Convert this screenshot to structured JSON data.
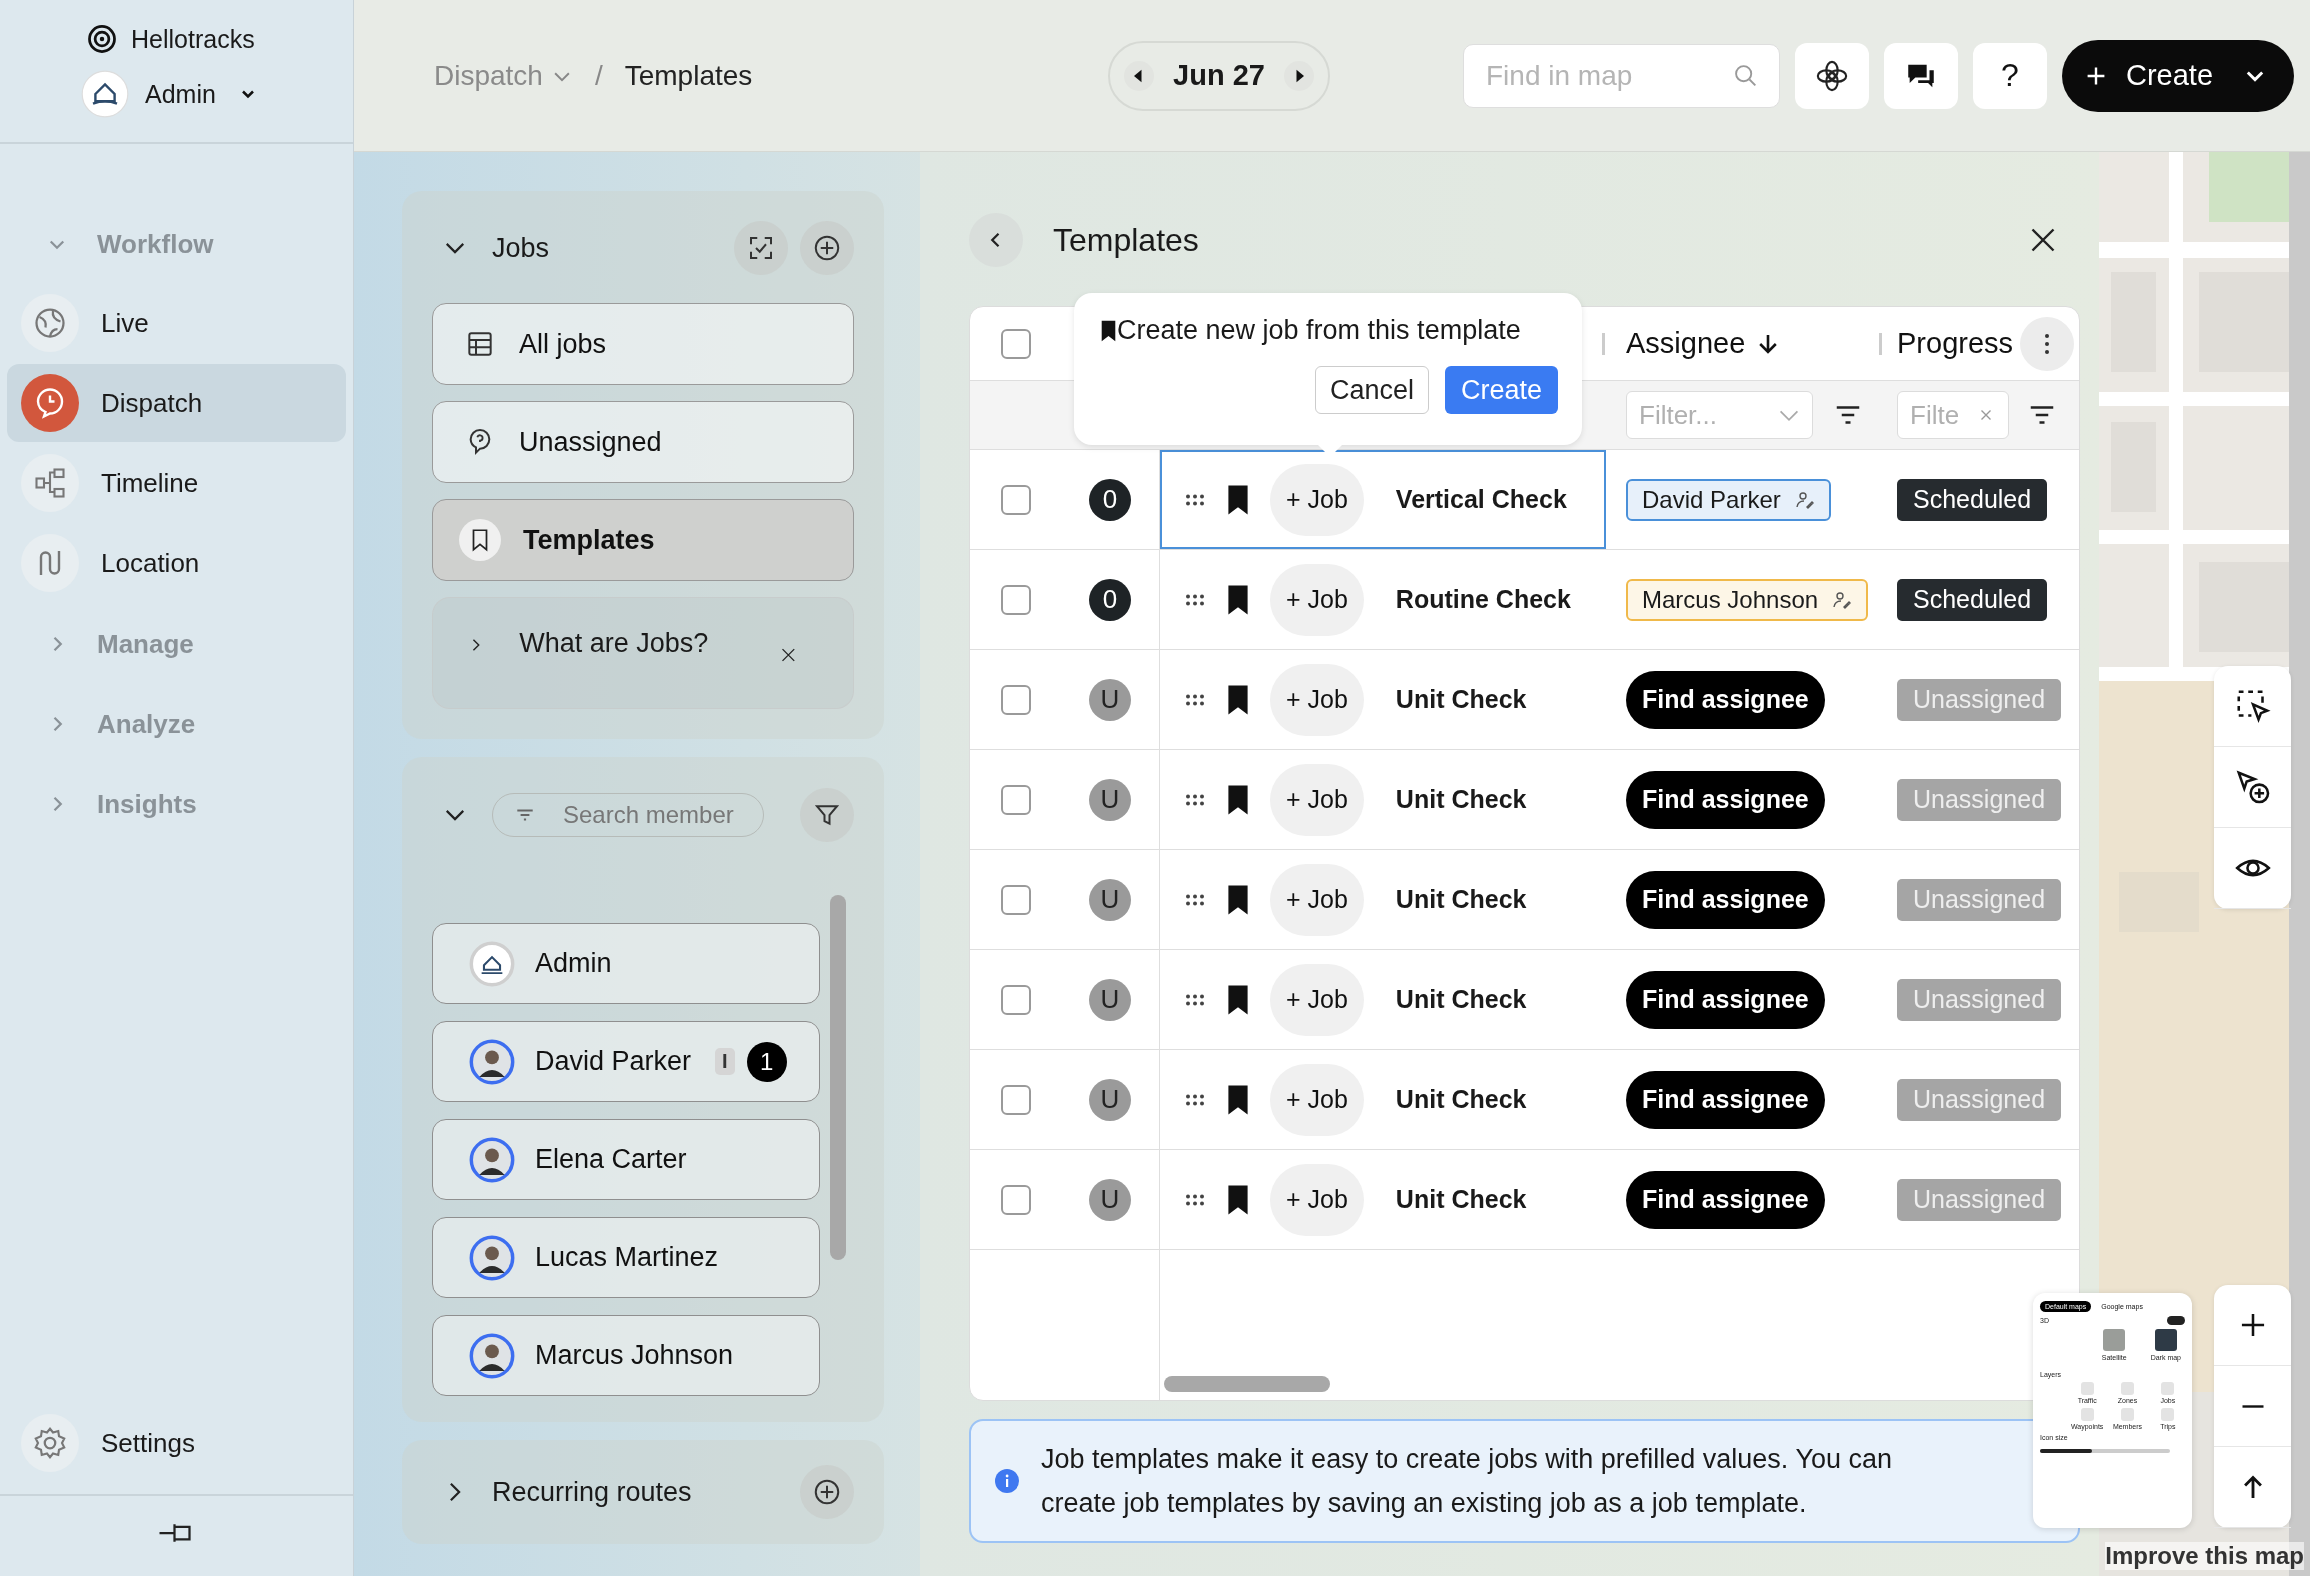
{
  "app": {
    "name": "Hellotracks",
    "account": "Admin"
  },
  "sidebar": {
    "sections": [
      {
        "label": "Workflow",
        "expanded": true,
        "items": [
          {
            "label": "Live",
            "selected": false
          },
          {
            "label": "Dispatch",
            "selected": true
          },
          {
            "label": "Timeline",
            "selected": false
          },
          {
            "label": "Location",
            "selected": false
          }
        ]
      },
      {
        "label": "Manage",
        "expanded": false
      },
      {
        "label": "Analyze",
        "expanded": false
      },
      {
        "label": "Insights",
        "expanded": false
      }
    ],
    "settings": "Settings"
  },
  "topbar": {
    "breadcrumb": [
      "Dispatch",
      "Templates"
    ],
    "separator": "/",
    "date": "Jun 27",
    "search": {
      "placeholder": "Find in map"
    },
    "help": "?",
    "create": "Create"
  },
  "jobs_panel": {
    "title": "Jobs",
    "expanded": true,
    "items": [
      {
        "label": "All jobs",
        "selected": false
      },
      {
        "label": "Unassigned",
        "selected": false
      },
      {
        "label": "Templates",
        "selected": true
      }
    ],
    "hint": {
      "label": "What are Jobs?",
      "expanded": false
    }
  },
  "members_panel": {
    "expanded": true,
    "search": {
      "placeholder": "Search member"
    },
    "members": [
      {
        "name": "Admin",
        "kind": "logo",
        "highlighted": false
      },
      {
        "name": "David Parker",
        "kind": "person",
        "highlighted": true,
        "tag": "I",
        "count": "1"
      },
      {
        "name": "Elena Carter",
        "kind": "person",
        "highlighted": true
      },
      {
        "name": "Lucas Martinez",
        "kind": "person",
        "highlighted": true
      },
      {
        "name": "Marcus Johnson",
        "kind": "person",
        "highlighted": true
      }
    ]
  },
  "recurring": {
    "label": "Recurring routes",
    "expanded": false
  },
  "templates": {
    "title": "Templates",
    "select_all_checked": false,
    "columns": [
      {
        "label": "Assignee",
        "sorted": true
      },
      {
        "label": "Progress",
        "sorted": false
      }
    ],
    "filters": [
      {
        "placeholder": "Filter..."
      },
      {
        "placeholder": "Filte"
      }
    ],
    "popup": {
      "text": "Create new job from this template",
      "cancel": "Cancel",
      "confirm": "Create"
    },
    "rows": [
      {
        "status": "0",
        "assigned": true,
        "checked": false,
        "selected": true,
        "job_button": "+ Job",
        "name": "Vertical Check",
        "assignee": {
          "kind": "member",
          "name": "David Parker",
          "color": "#4a90d9"
        },
        "progress": {
          "kind": "scheduled",
          "label": "Scheduled"
        }
      },
      {
        "status": "0",
        "assigned": true,
        "checked": false,
        "selected": false,
        "job_button": "+ Job",
        "name": "Routine Check",
        "assignee": {
          "kind": "member",
          "name": "Marcus Johnson",
          "color": "#f0b94a"
        },
        "progress": {
          "kind": "scheduled",
          "label": "Scheduled"
        }
      },
      {
        "status": "U",
        "assigned": false,
        "checked": false,
        "selected": false,
        "job_button": "+ Job",
        "name": "Unit Check",
        "assignee": {
          "kind": "find",
          "name": "Find assignee"
        },
        "progress": {
          "kind": "unassigned",
          "label": "Unassigned"
        }
      },
      {
        "status": "U",
        "assigned": false,
        "checked": false,
        "selected": false,
        "job_button": "+ Job",
        "name": "Unit Check",
        "assignee": {
          "kind": "find",
          "name": "Find assignee"
        },
        "progress": {
          "kind": "unassigned",
          "label": "Unassigned"
        }
      },
      {
        "status": "U",
        "assigned": false,
        "checked": false,
        "selected": false,
        "job_button": "+ Job",
        "name": "Unit Check",
        "assignee": {
          "kind": "find",
          "name": "Find assignee"
        },
        "progress": {
          "kind": "unassigned",
          "label": "Unassigned"
        }
      },
      {
        "status": "U",
        "assigned": false,
        "checked": false,
        "selected": false,
        "job_button": "+ Job",
        "name": "Unit Check",
        "assignee": {
          "kind": "find",
          "name": "Find assignee"
        },
        "progress": {
          "kind": "unassigned",
          "label": "Unassigned"
        }
      },
      {
        "status": "U",
        "assigned": false,
        "checked": false,
        "selected": false,
        "job_button": "+ Job",
        "name": "Unit Check",
        "assignee": {
          "kind": "find",
          "name": "Find assignee"
        },
        "progress": {
          "kind": "unassigned",
          "label": "Unassigned"
        }
      },
      {
        "status": "U",
        "assigned": false,
        "checked": false,
        "selected": false,
        "job_button": "+ Job",
        "name": "Unit Check",
        "assignee": {
          "kind": "find",
          "name": "Find assignee"
        },
        "progress": {
          "kind": "unassigned",
          "label": "Unassigned"
        }
      }
    ],
    "info": "Job templates make it easy to create jobs with prefilled values. You can create job templates by saving an existing job as a job template."
  },
  "map": {
    "improve_link": "Improve this map",
    "layers_card": {
      "tabs": [
        {
          "label": "Default maps",
          "selected": true
        },
        {
          "label": "Google maps",
          "selected": false
        }
      ],
      "mode": {
        "label": "3D",
        "on": true
      },
      "tiles": [
        "Satellite",
        "Dark map"
      ],
      "layers_title": "Layers",
      "layers": [
        "Traffic",
        "Zones",
        "Jobs",
        "Waypoints",
        "Members",
        "Trips"
      ],
      "icon_size": {
        "label": "Icon size",
        "level": 0.4
      }
    }
  }
}
